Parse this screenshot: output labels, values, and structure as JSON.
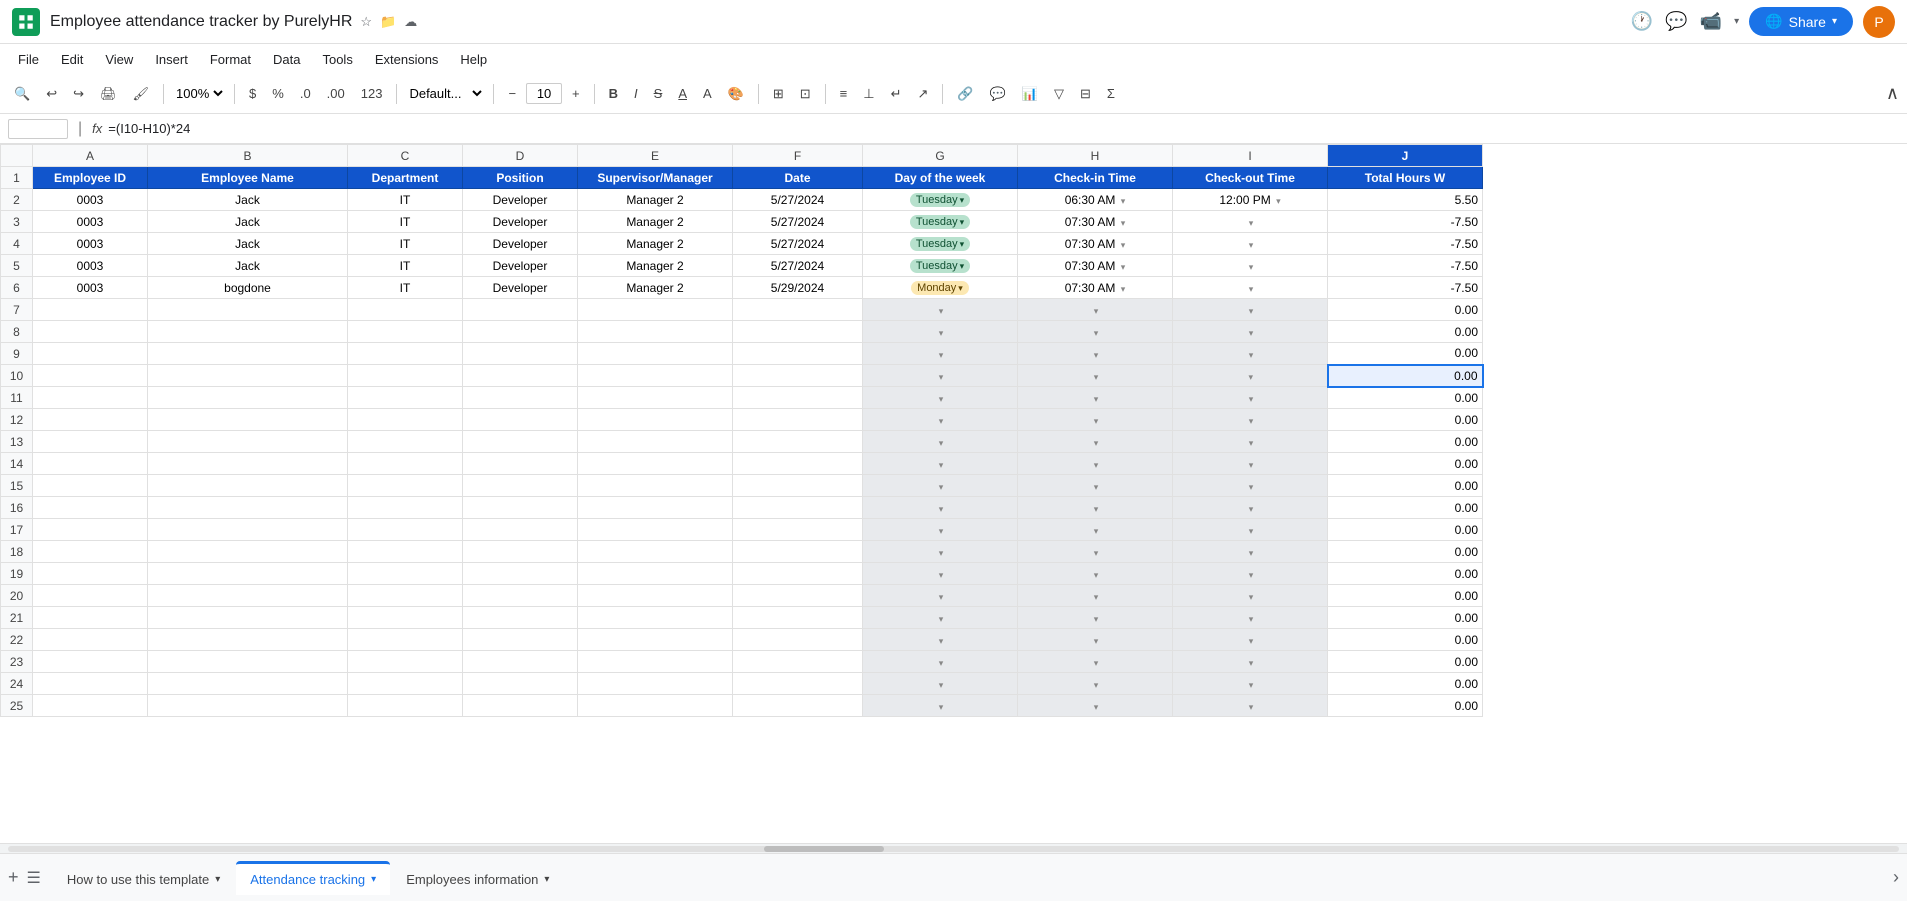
{
  "app": {
    "icon_color": "#0f9d58",
    "title": "Employee attendance tracker by PurelyHR",
    "avatar_letter": "P"
  },
  "menu": {
    "items": [
      "File",
      "Edit",
      "View",
      "Insert",
      "Format",
      "Data",
      "Tools",
      "Extensions",
      "Help"
    ]
  },
  "toolbar": {
    "zoom": "100%",
    "format": "Default...",
    "font_size": "10",
    "font": "Default..."
  },
  "formula_bar": {
    "cell_ref": "J10",
    "formula": "=(I10-H10)*24"
  },
  "columns": {
    "headers": [
      "A",
      "B",
      "C",
      "D",
      "E",
      "F",
      "G",
      "H",
      "I",
      "J"
    ],
    "labels": [
      "Employee ID",
      "Employee Name",
      "Department",
      "Position",
      "Supervisor/Manager",
      "Date",
      "Day of the week",
      "Check-in Time",
      "Check-out Time",
      "Total Hours W"
    ],
    "widths": [
      32,
      115,
      270,
      130,
      95,
      165,
      165,
      165,
      165,
      165,
      165
    ]
  },
  "rows": [
    {
      "id": "2",
      "emp_id": "0003",
      "name": "Jack",
      "dept": "IT",
      "pos": "Developer",
      "sup": "Manager 2",
      "date": "5/27/2024",
      "day": "Tuesday",
      "day_type": "tuesday",
      "checkin": "06:30 AM",
      "checkout": "12:00 PM",
      "hours": "5.50"
    },
    {
      "id": "3",
      "emp_id": "0003",
      "name": "Jack",
      "dept": "IT",
      "pos": "Developer",
      "sup": "Manager 2",
      "date": "5/27/2024",
      "day": "Tuesday",
      "day_type": "tuesday",
      "checkin": "07:30 AM",
      "checkout": "",
      "hours": "-7.50"
    },
    {
      "id": "4",
      "emp_id": "0003",
      "name": "Jack",
      "dept": "IT",
      "pos": "Developer",
      "sup": "Manager 2",
      "date": "5/27/2024",
      "day": "Tuesday",
      "day_type": "tuesday",
      "checkin": "07:30 AM",
      "checkout": "",
      "hours": "-7.50"
    },
    {
      "id": "5",
      "emp_id": "0003",
      "name": "Jack",
      "dept": "IT",
      "pos": "Developer",
      "sup": "Manager 2",
      "date": "5/27/2024",
      "day": "Tuesday",
      "day_type": "tuesday",
      "checkin": "07:30 AM",
      "checkout": "",
      "hours": "-7.50"
    },
    {
      "id": "6",
      "emp_id": "0003",
      "name": "bogdone",
      "dept": "IT",
      "pos": "Developer",
      "sup": "Manager 2",
      "date": "5/29/2024",
      "day": "Monday",
      "day_type": "monday",
      "checkin": "07:30 AM",
      "checkout": "",
      "hours": "-7.50"
    },
    {
      "id": "7",
      "hours": "0.00"
    },
    {
      "id": "8",
      "hours": "0.00"
    },
    {
      "id": "9",
      "hours": "0.00"
    },
    {
      "id": "10",
      "hours": "0.00",
      "selected": true
    },
    {
      "id": "11",
      "hours": "0.00"
    },
    {
      "id": "12",
      "hours": "0.00"
    },
    {
      "id": "13",
      "hours": "0.00"
    },
    {
      "id": "14",
      "hours": "0.00"
    },
    {
      "id": "15",
      "hours": "0.00"
    },
    {
      "id": "16",
      "hours": "0.00"
    },
    {
      "id": "17",
      "hours": "0.00"
    },
    {
      "id": "18",
      "hours": "0.00"
    },
    {
      "id": "19",
      "hours": "0.00"
    },
    {
      "id": "20",
      "hours": "0.00"
    },
    {
      "id": "21",
      "hours": "0.00"
    },
    {
      "id": "22",
      "hours": "0.00"
    },
    {
      "id": "23",
      "hours": "0.00"
    },
    {
      "id": "24",
      "hours": "0.00"
    },
    {
      "id": "25",
      "hours": "0.00"
    }
  ],
  "sheets": [
    {
      "label": "How to use this template",
      "active": false,
      "has_arrow": true
    },
    {
      "label": "Attendance tracking",
      "active": true,
      "has_arrow": true
    },
    {
      "label": "Employees information",
      "active": false,
      "has_arrow": true
    }
  ]
}
